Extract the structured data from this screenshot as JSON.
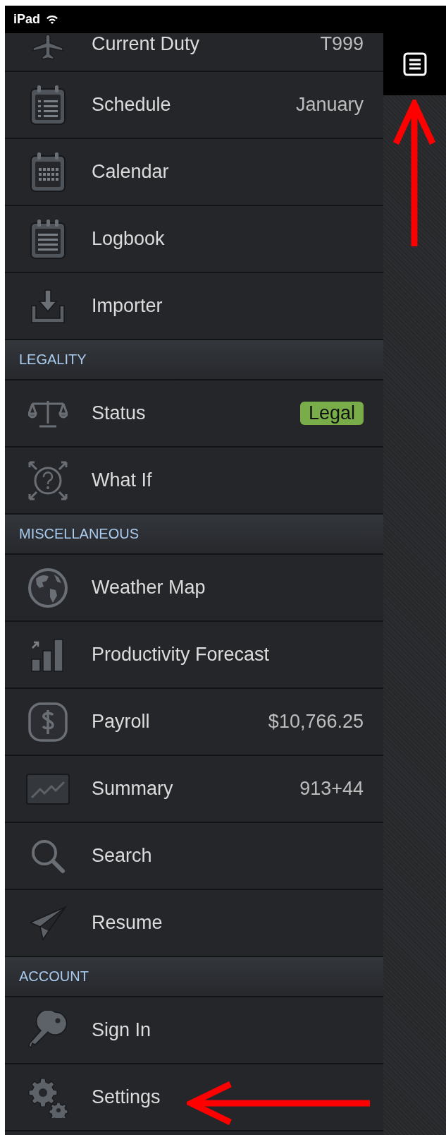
{
  "status_bar": {
    "device": "iPad"
  },
  "sections": [
    {
      "items": [
        {
          "label": "Current Duty",
          "value": "T999"
        },
        {
          "label": "Schedule",
          "value": "January"
        },
        {
          "label": "Calendar"
        },
        {
          "label": "Logbook"
        },
        {
          "label": "Importer"
        }
      ]
    },
    {
      "header": "LEGALITY",
      "items": [
        {
          "label": "Status",
          "badge": "Legal"
        },
        {
          "label": "What If"
        }
      ]
    },
    {
      "header": "MISCELLANEOUS",
      "items": [
        {
          "label": "Weather Map"
        },
        {
          "label": "Productivity Forecast"
        },
        {
          "label": "Payroll",
          "value": "$10,766.25"
        },
        {
          "label": "Summary",
          "value": "913+44"
        },
        {
          "label": "Search"
        },
        {
          "label": "Resume"
        }
      ]
    },
    {
      "header": "ACCOUNT",
      "items": [
        {
          "label": "Sign In"
        },
        {
          "label": "Settings"
        }
      ]
    }
  ]
}
